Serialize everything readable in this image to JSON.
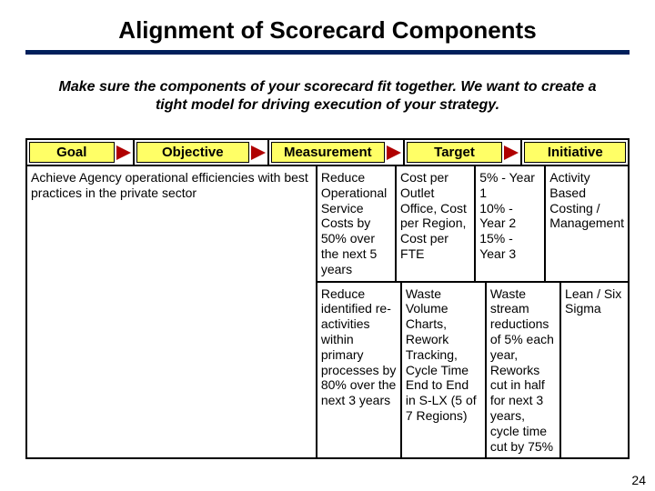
{
  "title": "Alignment of Scorecard Components",
  "subtitle": "Make sure the components of your scorecard fit together. We want to create a tight model for driving execution of your strategy.",
  "headers": {
    "goal": "Goal",
    "objective": "Objective",
    "measurement": "Measurement",
    "target": "Target",
    "initiative": "Initiative"
  },
  "goal": "Achieve Agency operational efficiencies with best practices in the private sector",
  "rows": [
    {
      "objective": "Reduce Operational Service Costs by 50% over the next 5 years",
      "measurement": "Cost per Outlet Office, Cost per Region, Cost per FTE",
      "target": "5% - Year 1\n10% - Year 2\n15% - Year 3",
      "initiative": "Activity Based Costing / Management"
    },
    {
      "objective": "Reduce identified re-activities within primary processes by 80% over the next 3 years",
      "measurement": " Waste Volume Charts, Rework Tracking, Cycle Time End to End in S-LX (5 of 7 Regions)",
      "target": "Waste stream reductions of 5% each year, Reworks cut in half for next 3 years, cycle time cut by 75%",
      "initiative": "Lean / Six Sigma"
    }
  ],
  "page_number": "24"
}
